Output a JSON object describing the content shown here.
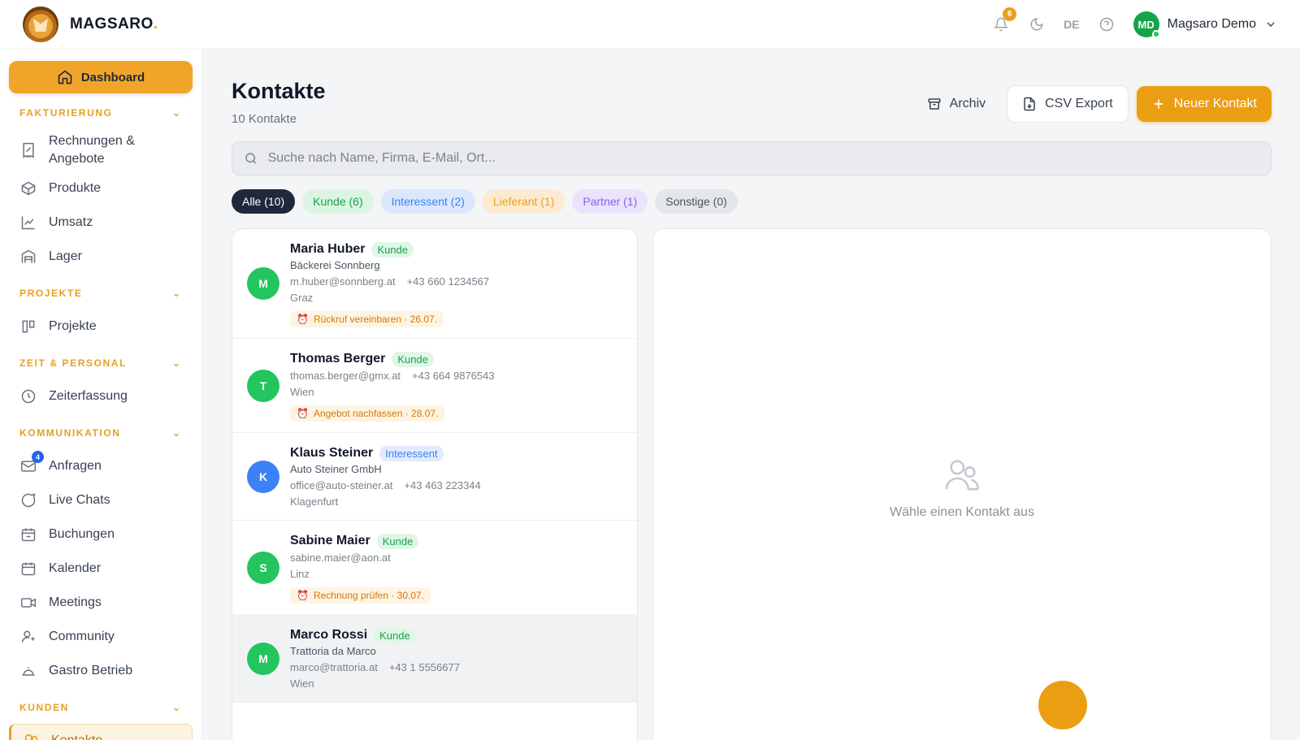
{
  "brand": {
    "name": "MAGSARO",
    "dot": "."
  },
  "topbar": {
    "notifications_count": "6",
    "language": "DE",
    "user_initials": "MD",
    "user_name": "Magsaro Demo"
  },
  "sidebar": {
    "dashboard_label": "Dashboard",
    "sections": {
      "fakturierung": "FAKTURIERUNG",
      "projekte": "PROJEKTE",
      "zeit": "ZEIT & PERSONAL",
      "kommunikation": "KOMMUNIKATION",
      "kunden": "KUNDEN"
    },
    "items": {
      "rechnungen": "Rechnungen & Angebote",
      "produkte": "Produkte",
      "umsatz": "Umsatz",
      "lager": "Lager",
      "projekte": "Projekte",
      "zeiterfassung": "Zeiterfassung",
      "anfragen": "Anfragen",
      "anfragen_badge": "4",
      "live_chats": "Live Chats",
      "buchungen": "Buchungen",
      "kalender": "Kalender",
      "meetings": "Meetings",
      "community": "Community",
      "gastro": "Gastro Betrieb",
      "kontakte": "Kontakte"
    }
  },
  "page": {
    "title": "Kontakte",
    "subtitle": "10 Kontakte",
    "archive_label": "Archiv",
    "csv_label": "CSV Export",
    "new_label": "Neuer Kontakt",
    "search_placeholder": "Suche nach Name, Firma, E-Mail, Ort..."
  },
  "filters": {
    "all": "Alle (10)",
    "kunde": "Kunde (6)",
    "interessent": "Interessent (2)",
    "lieferant": "Lieferant (1)",
    "partner": "Partner (1)",
    "sonstige": "Sonstige (0)"
  },
  "contacts": [
    {
      "initial": "M",
      "name": "Maria Huber",
      "tag": "Kunde",
      "company": "Bäckerei Sonnberg",
      "email": "m.huber@sonnberg.at",
      "phone": "+43 660 1234567",
      "city": "Graz",
      "reminder": "Rückruf vereinbaren · 26.07."
    },
    {
      "initial": "T",
      "name": "Thomas Berger",
      "tag": "Kunde",
      "email": "thomas.berger@gmx.at",
      "phone": "+43 664 9876543",
      "city": "Wien",
      "reminder": "Angebot nachfassen · 28.07."
    },
    {
      "initial": "K",
      "name": "Klaus Steiner",
      "tag": "Interessent",
      "company": "Auto Steiner GmbH",
      "email": "office@auto-steiner.at",
      "phone": "+43 463 223344",
      "city": "Klagenfurt"
    },
    {
      "initial": "S",
      "name": "Sabine Maier",
      "tag": "Kunde",
      "email": "sabine.maier@aon.at",
      "city": "Linz",
      "reminder": "Rechnung prüfen · 30.07."
    },
    {
      "initial": "M",
      "name": "Marco Rossi",
      "tag": "Kunde",
      "company": "Trattoria da Marco",
      "email": "marco@trattoria.at",
      "phone": "+43 1 5556677",
      "city": "Wien"
    }
  ],
  "colors": {
    "accent": "#ec9e12",
    "avatar_green": "#22c55e",
    "avatar_blue": "#3b82f6"
  },
  "detail": {
    "empty_text": "Wähle einen Kontakt aus"
  }
}
